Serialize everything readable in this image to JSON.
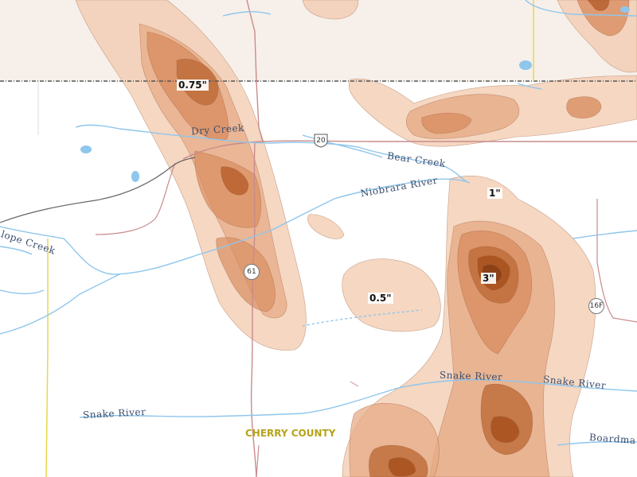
{
  "map": {
    "contour_labels": [
      "0.75\"",
      "1\"",
      "3\"",
      "0.5\""
    ],
    "river_labels": {
      "dry_creek": "Dry Creek",
      "bear_creek": "Bear Creek",
      "niobrara": "Niobrara River",
      "lope_creek": "lope Creek",
      "snake_left": "Snake River",
      "snake_mid": "Snake River",
      "snake_right": "Snake River",
      "boardman": "Boardma"
    },
    "route_shields": {
      "us20": "20",
      "n61": "61",
      "n16f": "16F"
    },
    "county_label": "CHERRY COUNTY",
    "colors": {
      "precip_light": "#f1c9ae",
      "precip_mid": "#d98f62",
      "precip_dark": "#a8521f",
      "contour_line": "#9a5a3a",
      "water": "#8fc6ec",
      "road": "#c98b8b",
      "highway": "#666666",
      "county_line": "#e8d94a",
      "state_line": "#555555"
    }
  }
}
